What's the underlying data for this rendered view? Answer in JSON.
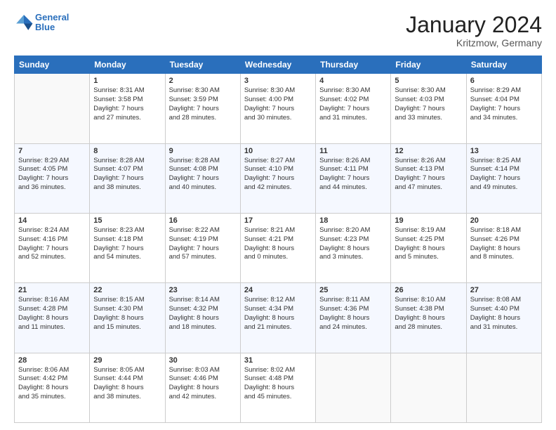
{
  "header": {
    "logo_line1": "General",
    "logo_line2": "Blue",
    "title": "January 2024",
    "subtitle": "Kritzmow, Germany"
  },
  "days_of_week": [
    "Sunday",
    "Monday",
    "Tuesday",
    "Wednesday",
    "Thursday",
    "Friday",
    "Saturday"
  ],
  "weeks": [
    [
      {
        "day": "",
        "info": ""
      },
      {
        "day": "1",
        "info": "Sunrise: 8:31 AM\nSunset: 3:58 PM\nDaylight: 7 hours\nand 27 minutes."
      },
      {
        "day": "2",
        "info": "Sunrise: 8:30 AM\nSunset: 3:59 PM\nDaylight: 7 hours\nand 28 minutes."
      },
      {
        "day": "3",
        "info": "Sunrise: 8:30 AM\nSunset: 4:00 PM\nDaylight: 7 hours\nand 30 minutes."
      },
      {
        "day": "4",
        "info": "Sunrise: 8:30 AM\nSunset: 4:02 PM\nDaylight: 7 hours\nand 31 minutes."
      },
      {
        "day": "5",
        "info": "Sunrise: 8:30 AM\nSunset: 4:03 PM\nDaylight: 7 hours\nand 33 minutes."
      },
      {
        "day": "6",
        "info": "Sunrise: 8:29 AM\nSunset: 4:04 PM\nDaylight: 7 hours\nand 34 minutes."
      }
    ],
    [
      {
        "day": "7",
        "info": "Sunrise: 8:29 AM\nSunset: 4:05 PM\nDaylight: 7 hours\nand 36 minutes."
      },
      {
        "day": "8",
        "info": "Sunrise: 8:28 AM\nSunset: 4:07 PM\nDaylight: 7 hours\nand 38 minutes."
      },
      {
        "day": "9",
        "info": "Sunrise: 8:28 AM\nSunset: 4:08 PM\nDaylight: 7 hours\nand 40 minutes."
      },
      {
        "day": "10",
        "info": "Sunrise: 8:27 AM\nSunset: 4:10 PM\nDaylight: 7 hours\nand 42 minutes."
      },
      {
        "day": "11",
        "info": "Sunrise: 8:26 AM\nSunset: 4:11 PM\nDaylight: 7 hours\nand 44 minutes."
      },
      {
        "day": "12",
        "info": "Sunrise: 8:26 AM\nSunset: 4:13 PM\nDaylight: 7 hours\nand 47 minutes."
      },
      {
        "day": "13",
        "info": "Sunrise: 8:25 AM\nSunset: 4:14 PM\nDaylight: 7 hours\nand 49 minutes."
      }
    ],
    [
      {
        "day": "14",
        "info": "Sunrise: 8:24 AM\nSunset: 4:16 PM\nDaylight: 7 hours\nand 52 minutes."
      },
      {
        "day": "15",
        "info": "Sunrise: 8:23 AM\nSunset: 4:18 PM\nDaylight: 7 hours\nand 54 minutes."
      },
      {
        "day": "16",
        "info": "Sunrise: 8:22 AM\nSunset: 4:19 PM\nDaylight: 7 hours\nand 57 minutes."
      },
      {
        "day": "17",
        "info": "Sunrise: 8:21 AM\nSunset: 4:21 PM\nDaylight: 8 hours\nand 0 minutes."
      },
      {
        "day": "18",
        "info": "Sunrise: 8:20 AM\nSunset: 4:23 PM\nDaylight: 8 hours\nand 3 minutes."
      },
      {
        "day": "19",
        "info": "Sunrise: 8:19 AM\nSunset: 4:25 PM\nDaylight: 8 hours\nand 5 minutes."
      },
      {
        "day": "20",
        "info": "Sunrise: 8:18 AM\nSunset: 4:26 PM\nDaylight: 8 hours\nand 8 minutes."
      }
    ],
    [
      {
        "day": "21",
        "info": "Sunrise: 8:16 AM\nSunset: 4:28 PM\nDaylight: 8 hours\nand 11 minutes."
      },
      {
        "day": "22",
        "info": "Sunrise: 8:15 AM\nSunset: 4:30 PM\nDaylight: 8 hours\nand 15 minutes."
      },
      {
        "day": "23",
        "info": "Sunrise: 8:14 AM\nSunset: 4:32 PM\nDaylight: 8 hours\nand 18 minutes."
      },
      {
        "day": "24",
        "info": "Sunrise: 8:12 AM\nSunset: 4:34 PM\nDaylight: 8 hours\nand 21 minutes."
      },
      {
        "day": "25",
        "info": "Sunrise: 8:11 AM\nSunset: 4:36 PM\nDaylight: 8 hours\nand 24 minutes."
      },
      {
        "day": "26",
        "info": "Sunrise: 8:10 AM\nSunset: 4:38 PM\nDaylight: 8 hours\nand 28 minutes."
      },
      {
        "day": "27",
        "info": "Sunrise: 8:08 AM\nSunset: 4:40 PM\nDaylight: 8 hours\nand 31 minutes."
      }
    ],
    [
      {
        "day": "28",
        "info": "Sunrise: 8:06 AM\nSunset: 4:42 PM\nDaylight: 8 hours\nand 35 minutes."
      },
      {
        "day": "29",
        "info": "Sunrise: 8:05 AM\nSunset: 4:44 PM\nDaylight: 8 hours\nand 38 minutes."
      },
      {
        "day": "30",
        "info": "Sunrise: 8:03 AM\nSunset: 4:46 PM\nDaylight: 8 hours\nand 42 minutes."
      },
      {
        "day": "31",
        "info": "Sunrise: 8:02 AM\nSunset: 4:48 PM\nDaylight: 8 hours\nand 45 minutes."
      },
      {
        "day": "",
        "info": ""
      },
      {
        "day": "",
        "info": ""
      },
      {
        "day": "",
        "info": ""
      }
    ]
  ]
}
